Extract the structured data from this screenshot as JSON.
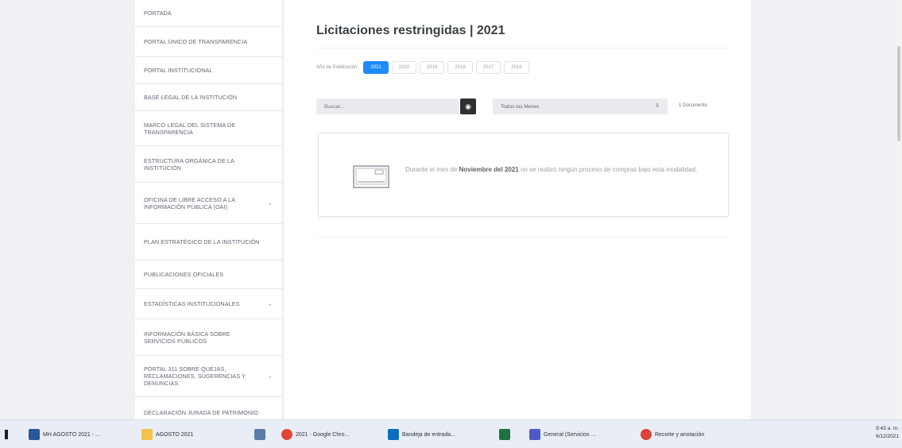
{
  "sidebar": {
    "items": [
      {
        "label": "PORTADA",
        "chevron": false
      },
      {
        "label": "PORTAL ÚNICO DE TRANSPARENCIA",
        "chevron": false
      },
      {
        "label": "PORTAL INSTITUCIONAL",
        "chevron": false
      },
      {
        "label": "BASE LEGAL DE LA INSTITUCIÓN",
        "chevron": false
      },
      {
        "label": "MARCO LEGAL DEL SISTEMA DE TRANSPARENCIA",
        "chevron": false
      },
      {
        "label": "ESTRUCTURA ORGÁNICA DE LA INSTITUCIÓN",
        "chevron": false
      },
      {
        "label": "OFICINA DE LIBRE ACCESO A LA INFORMACIÓN PÚBLICA (OAI)",
        "chevron": true
      },
      {
        "label": "PLAN ESTRATÉGICO DE LA INSTITUCIÓN",
        "chevron": false
      },
      {
        "label": "PUBLICACIONES OFICIALES",
        "chevron": false
      },
      {
        "label": "ESTADÍSTICAS INSTITUCIONALES",
        "chevron": true
      },
      {
        "label": "INFORMACIÓN BÁSICA SOBRE SERVICIOS PÚBLICOS",
        "chevron": false
      },
      {
        "label": "PORTAL 311 SOBRE QUEJAS, RECLAMACIONES, SUGERENCIAS Y DENUNCIAS",
        "chevron": true
      },
      {
        "label": "DECLARACIÓN JURADA DE PATRIMONIO",
        "chevron": false
      }
    ]
  },
  "main": {
    "title": "Licitaciones restringidas | 2021",
    "year_label": "Año de Publicación",
    "years": [
      "2021",
      "2020",
      "2019",
      "2018",
      "2017",
      "2016"
    ],
    "active_year": "2021",
    "search_placeholder": "Buscar...",
    "month_select": "Todos los Meses",
    "doc_count": "1 Documento",
    "empty_prefix": "Durante el mes de ",
    "empty_period": "Noviembre del 2021",
    "empty_suffix": " no se realizó ningún proceso de compras bajo esta modalidad."
  },
  "taskbar": {
    "items": [
      {
        "label": "MH AGOSTO 2021 - ...",
        "icon": "word-icon",
        "color": "#2b579a"
      },
      {
        "label": "AGOSTO 2021",
        "icon": "folder-icon",
        "color": "#f2c14e"
      },
      {
        "label": "",
        "icon": "notepad-icon",
        "color": "#5a7ea8"
      },
      {
        "label": "2021 - Google Chro...",
        "icon": "chrome-icon",
        "color": "#e0463a"
      },
      {
        "label": "Bandeja de entrada...",
        "icon": "outlook-icon",
        "color": "#0a6ebd"
      },
      {
        "label": "",
        "icon": "excel-icon",
        "color": "#1e7145"
      },
      {
        "label": "General (Servicios ...",
        "icon": "teams-icon",
        "color": "#5059c9"
      },
      {
        "label": "Recorte y anotación",
        "icon": "snip-icon",
        "color": "#d9453a"
      }
    ],
    "time": "9:43 a. m.",
    "date": "6/12/2021"
  }
}
